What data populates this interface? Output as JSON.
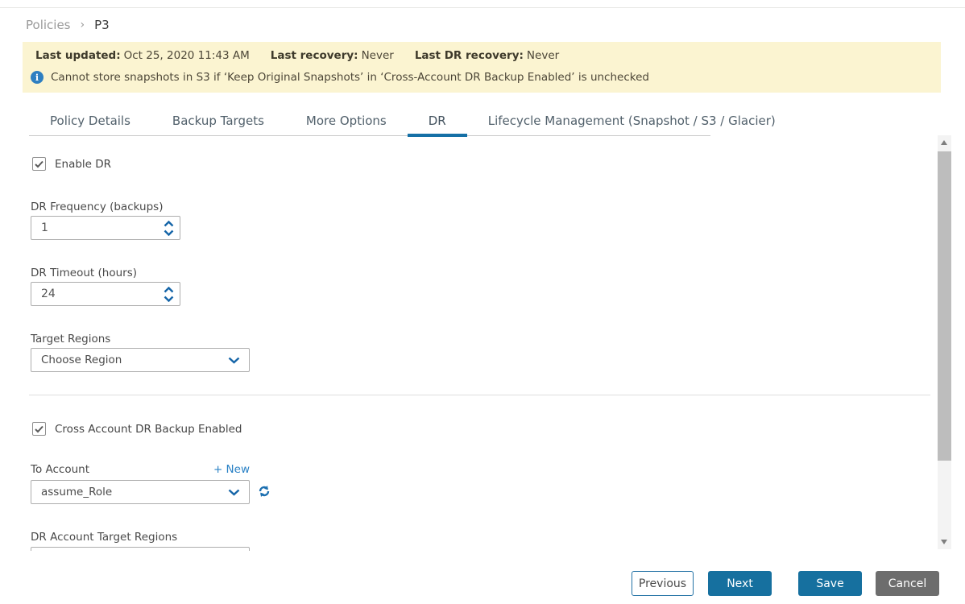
{
  "breadcrumb": {
    "parent": "Policies",
    "separator": "›",
    "current": "P3"
  },
  "banner": {
    "items": [
      {
        "label": "Last updated:",
        "value": "Oct 25, 2020 11:43 AM"
      },
      {
        "label": "Last recovery:",
        "value": "Never"
      },
      {
        "label": "Last DR recovery:",
        "value": "Never"
      }
    ],
    "info_icon_glyph": "i",
    "info_text": "Cannot store snapshots in S3 if ‘Keep Original Snapshots’ in ‘Cross-Account DR Backup Enabled’ is unchecked"
  },
  "tabs": [
    {
      "label": "Policy Details",
      "active": false
    },
    {
      "label": "Backup Targets",
      "active": false
    },
    {
      "label": "More Options",
      "active": false
    },
    {
      "label": "DR",
      "active": true
    },
    {
      "label": "Lifecycle Management (Snapshot / S3 / Glacier)",
      "active": false
    }
  ],
  "form": {
    "enable_dr": {
      "label": "Enable DR",
      "checked": true
    },
    "dr_frequency": {
      "label": "DR Frequency (backups)",
      "value": "1"
    },
    "dr_timeout": {
      "label": "DR Timeout (hours)",
      "value": "24"
    },
    "target_regions": {
      "label": "Target Regions",
      "value": "Choose Region"
    },
    "cross_account_dr": {
      "label": "Cross Account DR Backup Enabled",
      "checked": true
    },
    "to_account": {
      "label": "To Account",
      "new_link": "+ New",
      "value": "assume_Role"
    },
    "dr_account_target_regions": {
      "label": "DR Account Target Regions"
    }
  },
  "footer": {
    "previous": "Previous",
    "next": "Next",
    "save": "Save",
    "cancel": "Cancel"
  },
  "colors": {
    "accent_blue": "#16709f",
    "tab_underline": "#1570a6",
    "banner_bg": "#fbf4d1",
    "link_blue": "#2b82c6",
    "cancel_gray": "#6d6d6d",
    "info_icon_blue": "#2e7fc1"
  }
}
